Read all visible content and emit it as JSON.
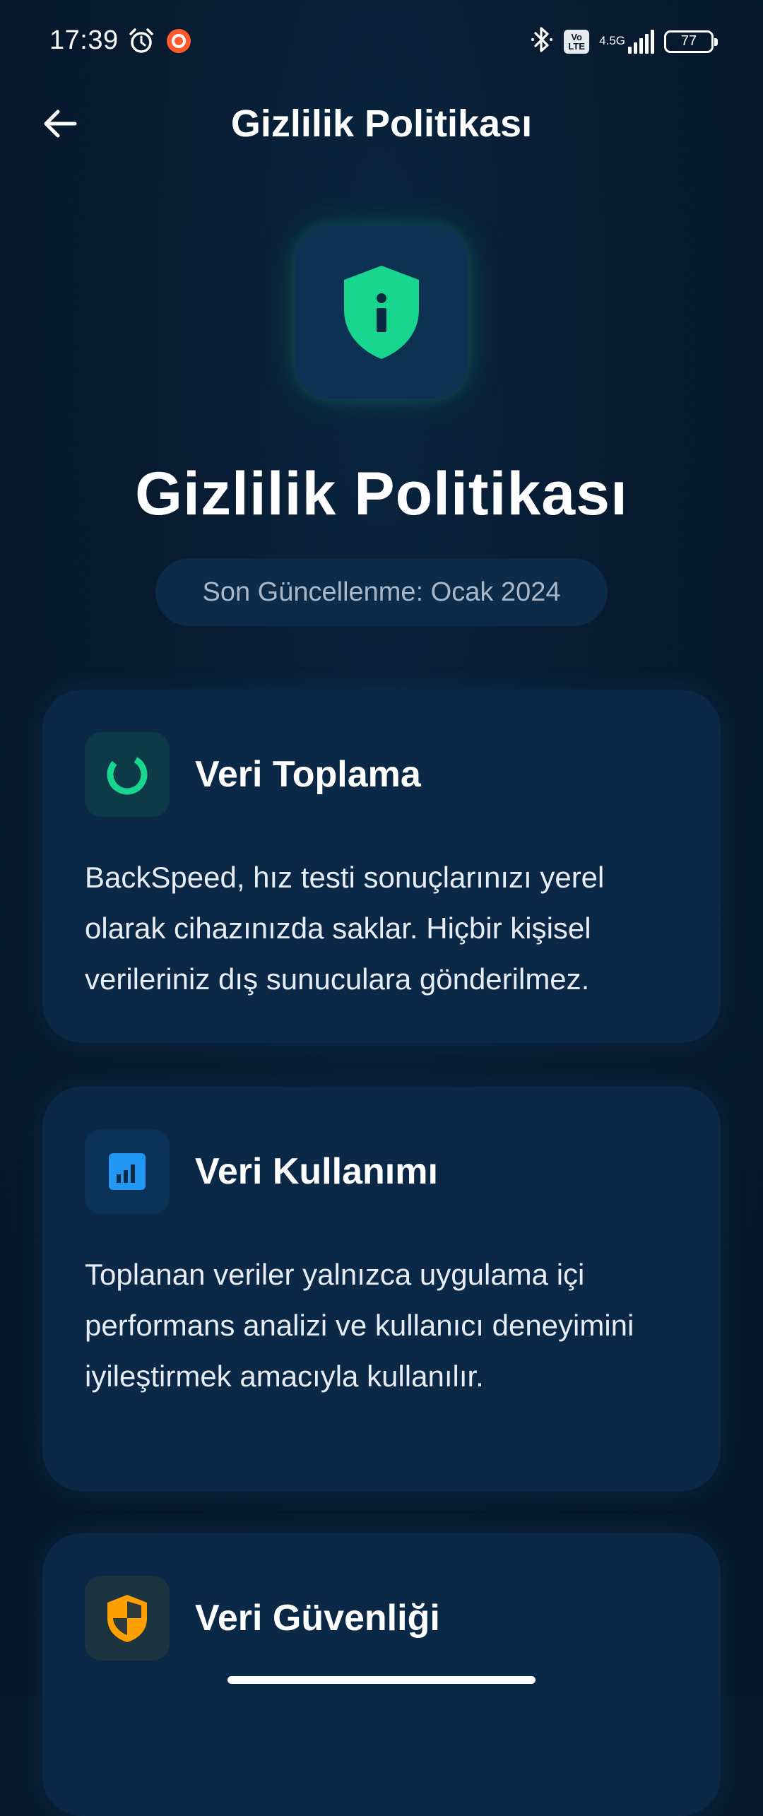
{
  "status_bar": {
    "time": "17:39",
    "left_icons": [
      "alarm-icon",
      "record-icon"
    ],
    "right_icons": [
      "bluetooth-icon",
      "volte-icon",
      "signal-icon",
      "battery-icon"
    ],
    "volte_top": "Vo",
    "volte_bottom": "LTE",
    "network": "4.5G",
    "battery": "77"
  },
  "app_bar": {
    "title": "Gizlilik Politikası",
    "back_icon": "arrow-left-icon"
  },
  "hero": {
    "icon": "shield-info-icon",
    "title": "Gizlilik Politikası",
    "updated": "Son Güncellenme: Ocak 2024"
  },
  "cards": [
    {
      "icon": "progress-ring-icon",
      "title": "Veri Toplama",
      "body": "BackSpeed, hız testi sonuçlarınızı yerel olarak cihazınızda saklar. Hiçbir kişisel verileriniz dış sunuculara gönderilmez."
    },
    {
      "icon": "bar-chart-icon",
      "title": "Veri Kullanımı",
      "body": "Toplanan veriler yalnızca uygulama içi performans analizi ve kullanıcı deneyimini iyileştirmek amacıyla kullanılır."
    },
    {
      "icon": "shield-icon",
      "title": "Veri Güvenliği",
      "body": ""
    }
  ],
  "colors": {
    "background": "#061628",
    "card": "#0b2846",
    "green": "#19d68f",
    "blue": "#2196f3",
    "orange": "#ffa000",
    "muted_text": "#a9b8c8"
  }
}
